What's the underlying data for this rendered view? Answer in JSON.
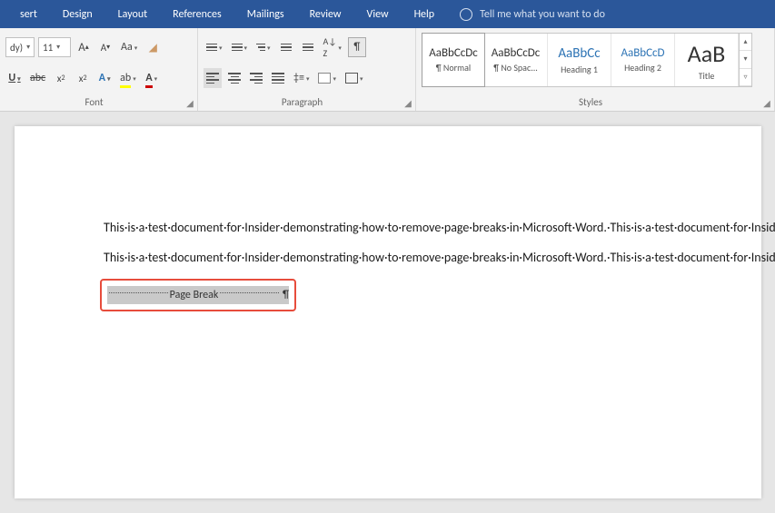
{
  "menu": {
    "items": [
      "sert",
      "Design",
      "Layout",
      "References",
      "Mailings",
      "Review",
      "View",
      "Help"
    ],
    "tell_me": "Tell me what you want to do"
  },
  "font_group": {
    "label": "Font",
    "font_name": "dy)",
    "font_size": "11"
  },
  "paragraph_group": {
    "label": "Paragraph"
  },
  "styles_group": {
    "label": "Styles",
    "items": [
      {
        "preview": "AaBbCcDc",
        "name": "¶ Normal",
        "cls": "calibri"
      },
      {
        "preview": "AaBbCcDc",
        "name": "¶ No Spac...",
        "cls": "calibri"
      },
      {
        "preview": "AaBbCc",
        "name": "Heading 1",
        "cls": "blue"
      },
      {
        "preview": "AaBbCcD",
        "name": "Heading 2",
        "cls": "blue"
      },
      {
        "preview": "AaB",
        "name": "Title",
        "cls": "big"
      }
    ]
  },
  "document": {
    "para1": "This·is·a·test·document·for·Insider·demonstrating·how·to·remove·page·breaks·in·Microsoft·Word.·This·is·a·test·document·for·Insider·demonstrating·how·to·remove·page·breaks·in·Microsoft·Word.·This·is·a·test·document·for·Insider·demonstrating·how·to·remove·page·breaks·in·Microsoft·Word.·This·is·a·test·document·for·Insider·demonstrating·how·to·remove·page·breaks·in·Microsoft·Word.·This·is·a·test·document·for·Insider·demonstrating·how·to·remove·page·breaks·in·Microsoft·Word.¶",
    "para2": "This·is·a·test·document·for·Insider·demonstrating·how·to·remove·page·breaks·in·Microsoft·Word.·This·is·a·test·document·for·Insider·demonstrating·how·to·remove·page·breaks·in·Microsoft·Word.·This·is·a·test·document·for·Insider·demonstrating·how·to·remove·page·breaks·in·Microsoft·Word.·This·is·a·test·document·for·Insider·demonstrating·how·to·remove·page·breaks·in·Microsoft·Word.·This·is·a·test·document·for·Insider·demonstrating·how·to·remove·page·breaks·in·Microsoft·Word.¶",
    "page_break_label": "Page Break",
    "pilcrow": "¶"
  }
}
